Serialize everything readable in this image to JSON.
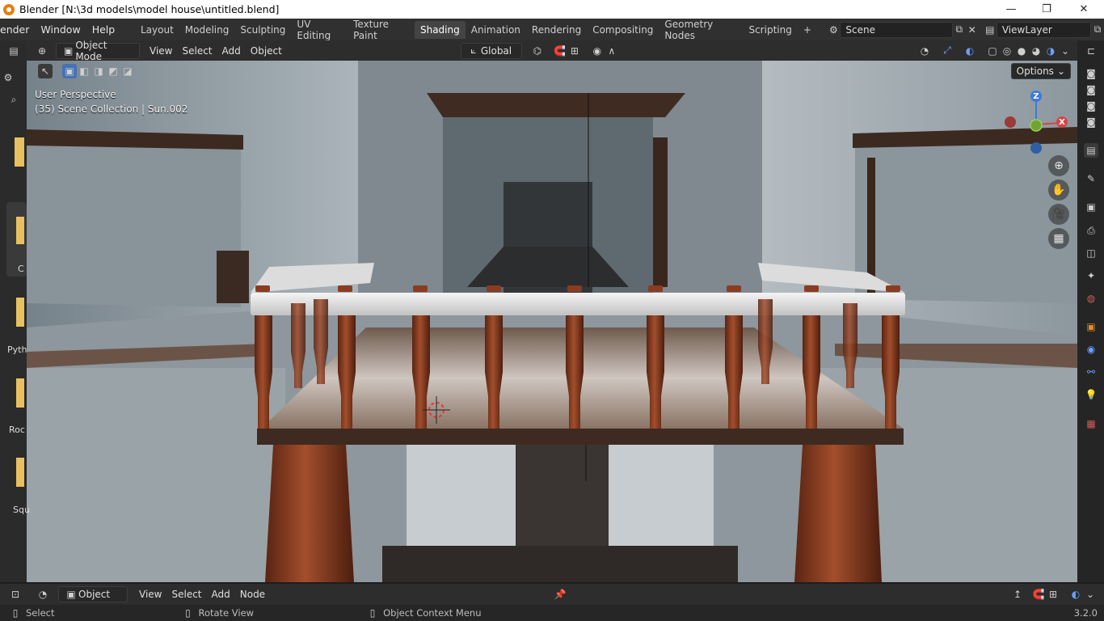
{
  "window": {
    "title": "Blender [N:\\3d models\\model house\\untitled.blend]",
    "minimize": "—",
    "maximize": "❐",
    "close": "✕"
  },
  "menus": [
    "ender",
    "Window",
    "Help"
  ],
  "workspaces": [
    "Layout",
    "Modeling",
    "Sculpting",
    "UV Editing",
    "Texture Paint",
    "Shading",
    "Animation",
    "Rendering",
    "Compositing",
    "Geometry Nodes",
    "Scripting"
  ],
  "active_workspace": "Shading",
  "add_workspace": "+",
  "scene": {
    "name": "Scene",
    "view_layer": "ViewLayer"
  },
  "viewport_header": {
    "mode": "Object Mode",
    "menus": [
      "View",
      "Select",
      "Add",
      "Object"
    ],
    "orientation": "Global",
    "options": "Options"
  },
  "viewport": {
    "perspective": "User Perspective",
    "collection": "(35) Scene Collection | Sun.002",
    "axes": {
      "z": "Z",
      "x": "X"
    }
  },
  "left_strip": {
    "labels": [
      "C",
      "Pyth",
      "Roc",
      "Squ"
    ]
  },
  "bottom_header": {
    "editor": "Object",
    "menus": [
      "View",
      "Select",
      "Add",
      "Node"
    ]
  },
  "status": {
    "select": "Select",
    "rotate": "Rotate View",
    "context": "Object Context Menu",
    "version": "3.2.0"
  },
  "colors": {
    "accent": "#4772b3",
    "header": "#2d2d2d",
    "wall": "#8d979d",
    "wood": "#7a3a22",
    "rail": "#e8e8e8"
  }
}
